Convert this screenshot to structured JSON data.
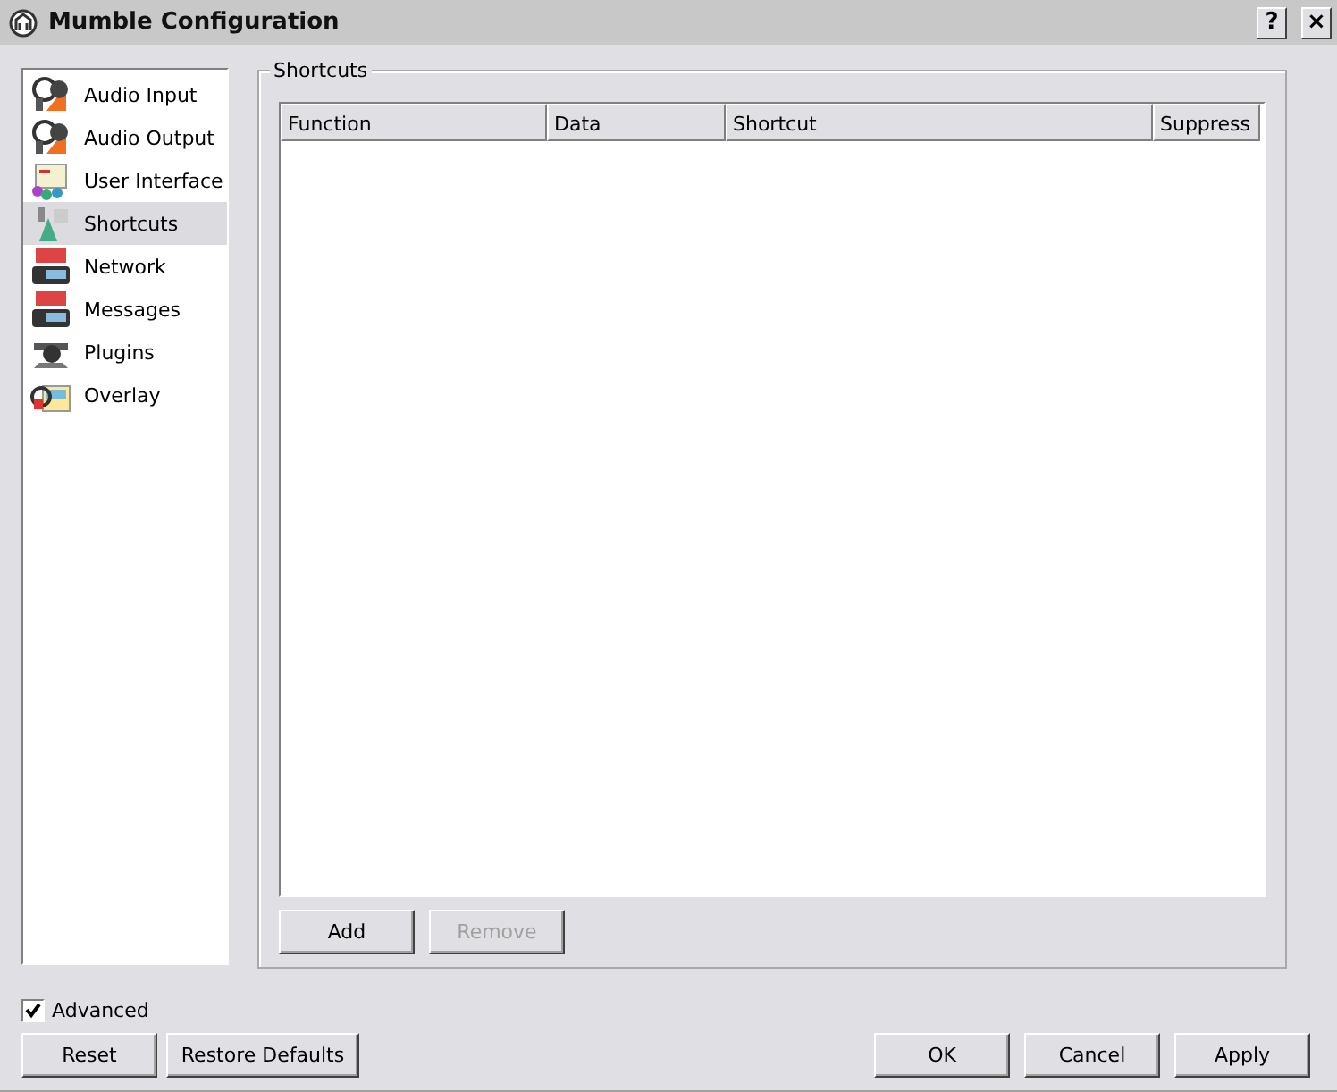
{
  "window": {
    "title": "Mumble Configuration",
    "buttons": [
      "?",
      "×"
    ]
  },
  "sidebar": {
    "items": [
      {
        "label": "Audio Input",
        "selected": false
      },
      {
        "label": "Audio Output",
        "selected": false
      },
      {
        "label": "User Interface",
        "selected": false
      },
      {
        "label": "Shortcuts",
        "selected": true
      },
      {
        "label": "Network",
        "selected": false
      },
      {
        "label": "Messages",
        "selected": false
      },
      {
        "label": "Plugins",
        "selected": false
      },
      {
        "label": "Overlay",
        "selected": false
      }
    ]
  },
  "group": {
    "title": "Shortcuts",
    "table": {
      "columns": [
        "Function",
        "Data",
        "Shortcut",
        "Suppress"
      ]
    },
    "buttons": [
      {
        "label": "Add",
        "disabled": false
      },
      {
        "label": "Remove",
        "disabled": true
      }
    ]
  },
  "advanced": {
    "label": "Advanced",
    "checked": true
  },
  "left_buttons": [
    "Reset",
    "Restore Defaults"
  ],
  "right_buttons": [
    "OK",
    "Cancel",
    "Apply"
  ]
}
